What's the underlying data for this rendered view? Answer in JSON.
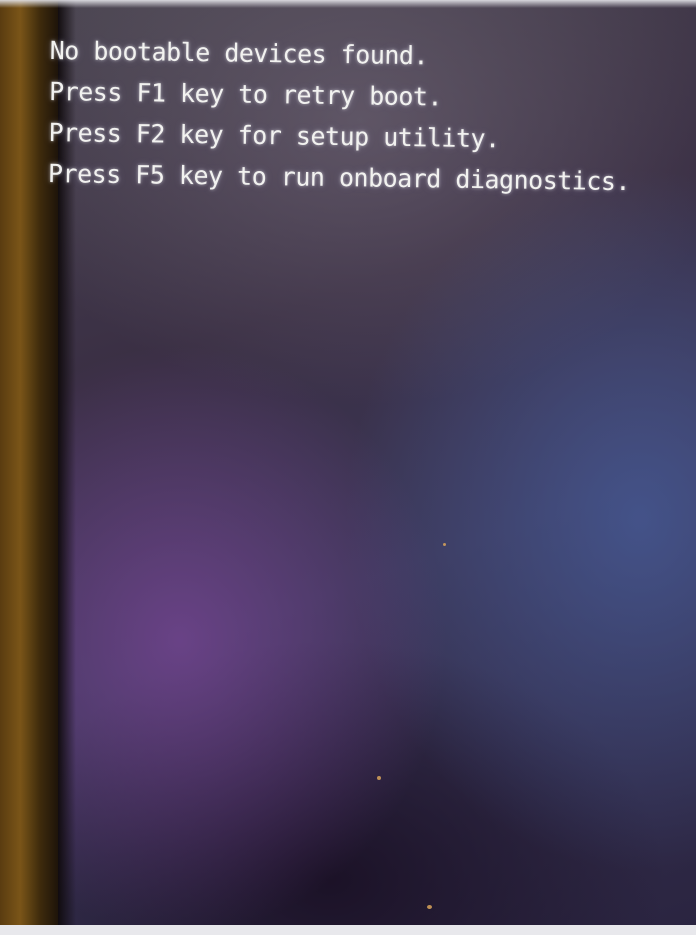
{
  "screen": {
    "messages": [
      "No bootable devices found.",
      "Press F1 key to retry boot.",
      "Press F2 key for setup utility.",
      "Press F5 key to run onboard diagnostics."
    ]
  },
  "colors": {
    "text": "#f2f2f0",
    "bezel": "#7a5518",
    "screen_background": "#3a2f44"
  }
}
